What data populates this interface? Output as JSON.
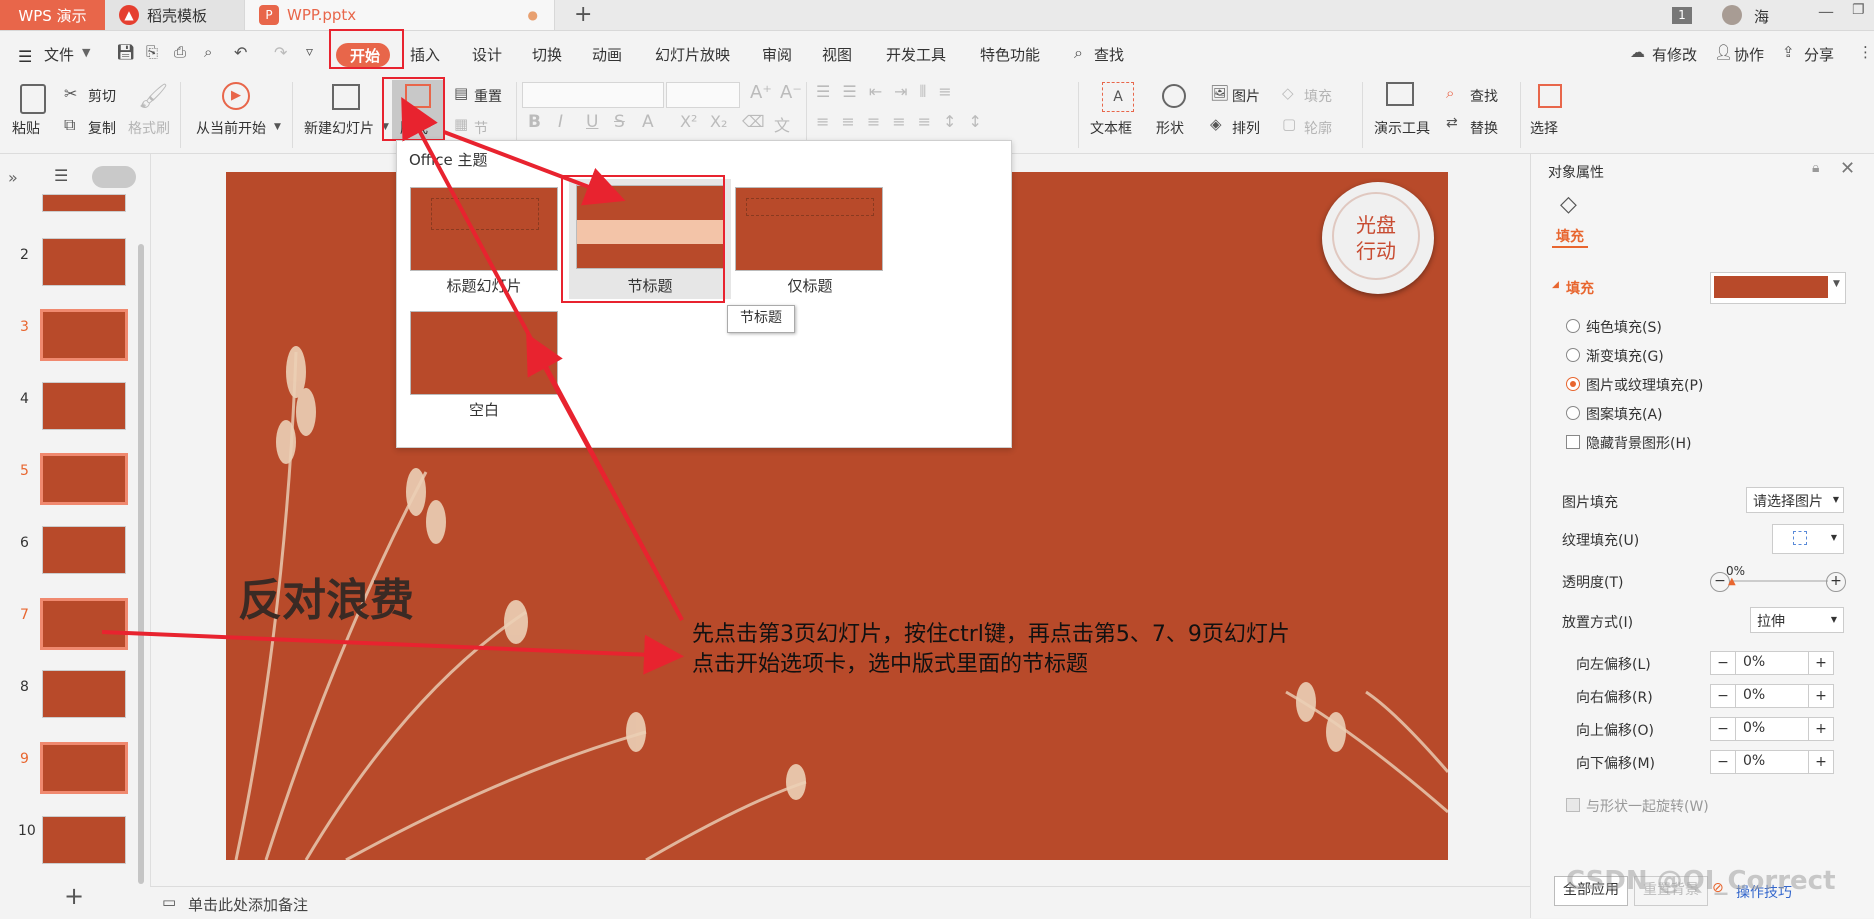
{
  "titlebar": {
    "app_tab": "WPS 演示",
    "tabs": [
      {
        "label": "稻壳模板"
      },
      {
        "label": "WPP.pptx"
      }
    ],
    "new_tab": "+",
    "badge": "1",
    "user_name": "海"
  },
  "menu": {
    "file": "文件",
    "tabs": [
      "开始",
      "插入",
      "设计",
      "切换",
      "动画",
      "幻灯片放映",
      "审阅",
      "视图",
      "开发工具",
      "特色功能"
    ],
    "search": "查找",
    "has_changes": "有修改",
    "collab": "协作",
    "share": "分享"
  },
  "ribbon": {
    "paste": "粘贴",
    "cut": "剪切",
    "copy": "复制",
    "format_painter": "格式刷",
    "from_current": "从当前开始",
    "new_slide": "新建幻灯片",
    "layout": "版式",
    "reset": "重置",
    "section": "节",
    "textbox": "文本框",
    "shape": "形状",
    "picture": "图片",
    "arrange": "排列",
    "fill": "填充",
    "outline": "轮廓",
    "present_tools": "演示工具",
    "find": "查找",
    "replace": "替换",
    "select": "选择"
  },
  "thumbnails": [
    {
      "num": "2",
      "selected": false
    },
    {
      "num": "3",
      "selected": true
    },
    {
      "num": "4",
      "selected": false
    },
    {
      "num": "5",
      "selected": true
    },
    {
      "num": "6",
      "selected": false
    },
    {
      "num": "7",
      "selected": true
    },
    {
      "num": "8",
      "selected": false
    },
    {
      "num": "9",
      "selected": true
    },
    {
      "num": "10",
      "selected": false
    }
  ],
  "layout_popup": {
    "header": "Office 主题",
    "layouts": [
      "标题幻灯片",
      "节标题",
      "仅标题",
      "空白"
    ],
    "tooltip": "节标题"
  },
  "slide": {
    "title": "反对浪费",
    "stamp": "光盘\n行动",
    "note_line1": "先点击第3页幻灯片，按住ctrl键，再点击第5、7、9页幻灯片",
    "note_line2": "点击开始选项卡，选中版式里面的节标题"
  },
  "notes_placeholder": "单击此处添加备注",
  "right_pane": {
    "title": "对象属性",
    "fill_tab": "填充",
    "fill_section": "填充",
    "options": [
      "纯色填充(S)",
      "渐变填充(G)",
      "图片或纹理填充(P)",
      "图案填充(A)"
    ],
    "hide_bg": "隐藏背景图形(H)",
    "picture_fill_label": "图片填充",
    "picture_fill_value": "请选择图片",
    "texture_fill_label": "纹理填充(U)",
    "transparency_label": "透明度(T)",
    "transparency_value": "0%",
    "placement_label": "放置方式(I)",
    "placement_value": "拉伸",
    "offsets": [
      {
        "label": "向左偏移(L)",
        "value": "0%"
      },
      {
        "label": "向右偏移(R)",
        "value": "0%"
      },
      {
        "label": "向上偏移(O)",
        "value": "0%"
      },
      {
        "label": "向下偏移(M)",
        "value": "0%"
      }
    ],
    "rotate_with_shape": "与形状一起旋转(W)",
    "apply_all": "全部应用",
    "reset_bg": "重置背景",
    "tips": "操作技巧"
  },
  "watermark": "CSDN @QI_Correct",
  "colors": {
    "accent": "#e8664a",
    "slide_bg": "#b84a2a",
    "annotation": "#e8232f"
  }
}
